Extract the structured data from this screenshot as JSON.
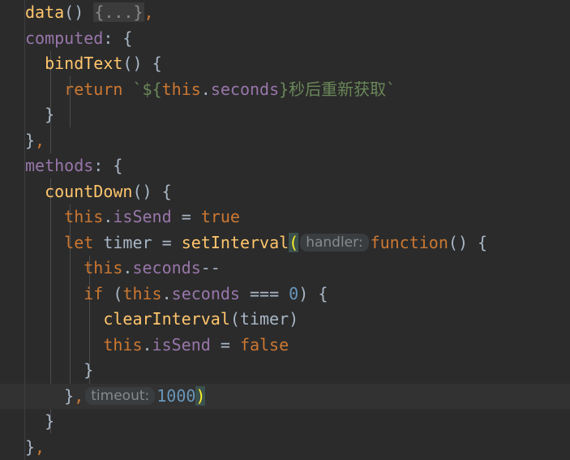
{
  "editor": {
    "theme": "Darcula",
    "language": "JavaScript",
    "colors": {
      "background": "#2b2b2b",
      "current_line": "#323232",
      "gutter_divider": "#3c3f41",
      "indent_guide": "#4b4b4b",
      "keyword": "#cc7832",
      "function": "#ffc66d",
      "property": "#9876aa",
      "number": "#6897bb",
      "string": "#6a8759",
      "default_text": "#a9b7c6",
      "fold_background": "#3b3b3b",
      "fold_text": "#8a8a8a",
      "inlay_hint_background": "#3a3d3f",
      "inlay_hint_text": "#868a8c",
      "bracket_match_background": "#3b514d",
      "bracket_match_text": "#ffef28"
    },
    "current_line_number": 15,
    "total_visible_lines": 18
  },
  "code_lines": [
    {
      "index": 0,
      "indent": 1,
      "text": "data() {...},"
    },
    {
      "index": 1,
      "indent": 1,
      "text": "computed: {"
    },
    {
      "index": 2,
      "indent": 2,
      "text": "bindText() {"
    },
    {
      "index": 3,
      "indent": 3,
      "text": "return `${this.seconds}秒后重新获取`"
    },
    {
      "index": 4,
      "indent": 2,
      "text": "}"
    },
    {
      "index": 5,
      "indent": 1,
      "text": "},"
    },
    {
      "index": 6,
      "indent": 1,
      "text": "methods: {"
    },
    {
      "index": 7,
      "indent": 2,
      "text": "countDown() {"
    },
    {
      "index": 8,
      "indent": 3,
      "text": "this.isSend = true"
    },
    {
      "index": 9,
      "indent": 3,
      "text": "let timer = setInterval(handler: function() {"
    },
    {
      "index": 10,
      "indent": 4,
      "text": "this.seconds--"
    },
    {
      "index": 11,
      "indent": 4,
      "text": "if (this.seconds === 0) {"
    },
    {
      "index": 12,
      "indent": 5,
      "text": "clearInterval(timer)"
    },
    {
      "index": 13,
      "indent": 5,
      "text": "this.isSend = false"
    },
    {
      "index": 14,
      "indent": 4,
      "text": "}"
    },
    {
      "index": 15,
      "indent": 3,
      "text": "}, timeout: 1000)"
    },
    {
      "index": 16,
      "indent": 2,
      "text": "}"
    },
    {
      "index": 17,
      "indent": 1,
      "text": "},"
    }
  ],
  "tokens": {
    "data_name": "data",
    "paren_open": "(",
    "paren_close": ")",
    "fold_placeholder": "{...}",
    "comma": ",",
    "computed_key": "computed",
    "colon": ":",
    "brace_open": "{",
    "brace_close": "}",
    "bindText_name": "bindText",
    "return_kw": "return",
    "backtick": "`",
    "dollar_brace": "${",
    "this_kw": "this",
    "dot": ".",
    "seconds_prop": "seconds",
    "close_brace_interp": "}",
    "chinese_literal": "秒后重新获取",
    "methods_key": "methods",
    "countDown_name": "countDown",
    "isSend_prop": "isSend",
    "assign_op": "=",
    "true_kw": "true",
    "false_kw": "false",
    "let_kw": "let",
    "timer_var": "timer",
    "setInterval_fn": "setInterval",
    "handler_hint": "handler:",
    "function_kw": "function",
    "decrement_op": "--",
    "if_kw": "if",
    "strict_eq_op": "===",
    "zero_literal": "0",
    "clearInterval_fn": "clearInterval",
    "timeout_hint": "timeout:",
    "timeout_value": "1000"
  }
}
